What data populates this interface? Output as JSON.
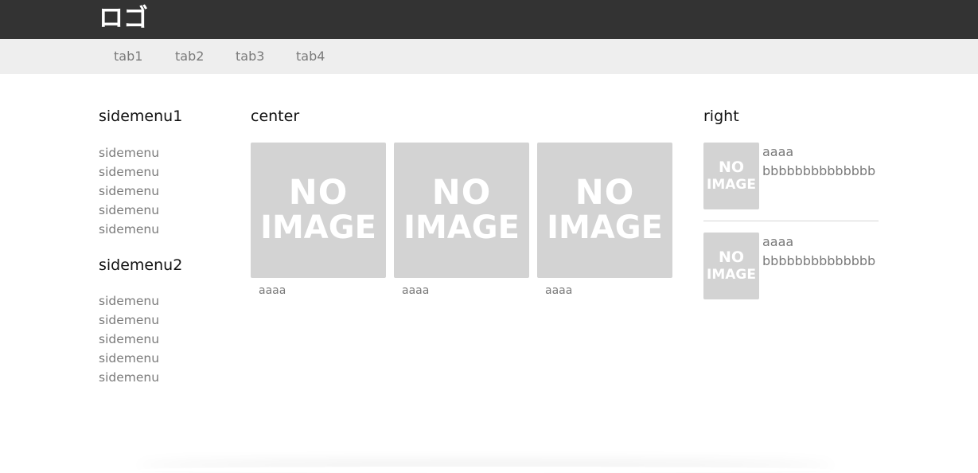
{
  "header": {
    "logo": "ロゴ",
    "bg_color": "#333333"
  },
  "nav": {
    "tabs": [
      {
        "label": "tab1"
      },
      {
        "label": "tab2"
      },
      {
        "label": "tab3"
      },
      {
        "label": "tab4"
      }
    ]
  },
  "sidebar": {
    "groups": [
      {
        "title": "sidemenu1",
        "items": [
          "sidemenu",
          "sidemenu",
          "sidemenu",
          "sidemenu",
          "sidemenu"
        ]
      },
      {
        "title": "sidemenu2",
        "items": [
          "sidemenu",
          "sidemenu",
          "sidemenu",
          "sidemenu",
          "sidemenu"
        ]
      }
    ]
  },
  "center": {
    "title": "center",
    "cards": [
      {
        "image_line1": "NO",
        "image_line2": "IMAGE",
        "caption": "aaaa"
      },
      {
        "image_line1": "NO",
        "image_line2": "IMAGE",
        "caption": "aaaa"
      },
      {
        "image_line1": "NO",
        "image_line2": "IMAGE",
        "caption": "aaaa"
      }
    ]
  },
  "right": {
    "title": "right",
    "items": [
      {
        "image_line1": "NO",
        "image_line2": "IMAGE",
        "title": "aaaa",
        "text": "bbbbbbbbbbbbbb"
      },
      {
        "image_line1": "NO",
        "image_line2": "IMAGE",
        "title": "aaaa",
        "text": "bbbbbbbbbbbbbb"
      }
    ]
  },
  "colors": {
    "tabbar_bg": "#eeeeee",
    "placeholder_bg": "#d3d3d3",
    "link_text": "#7a7a7a"
  }
}
